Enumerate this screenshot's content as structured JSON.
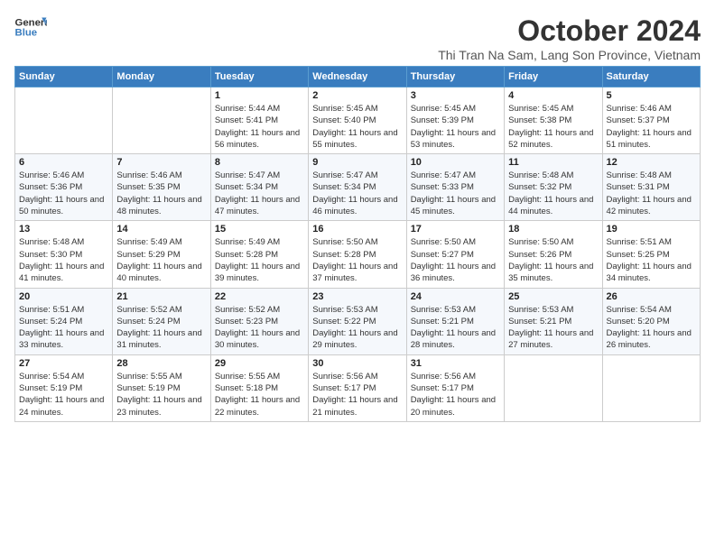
{
  "header": {
    "logo": {
      "line1": "General",
      "line2": "Blue"
    },
    "title": "October 2024",
    "subtitle": "Thi Tran Na Sam, Lang Son Province, Vietnam"
  },
  "days_of_week": [
    "Sunday",
    "Monday",
    "Tuesday",
    "Wednesday",
    "Thursday",
    "Friday",
    "Saturday"
  ],
  "weeks": [
    [
      {
        "day": "",
        "sunrise": "",
        "sunset": "",
        "daylight": ""
      },
      {
        "day": "",
        "sunrise": "",
        "sunset": "",
        "daylight": ""
      },
      {
        "day": "1",
        "sunrise": "Sunrise: 5:44 AM",
        "sunset": "Sunset: 5:41 PM",
        "daylight": "Daylight: 11 hours and 56 minutes."
      },
      {
        "day": "2",
        "sunrise": "Sunrise: 5:45 AM",
        "sunset": "Sunset: 5:40 PM",
        "daylight": "Daylight: 11 hours and 55 minutes."
      },
      {
        "day": "3",
        "sunrise": "Sunrise: 5:45 AM",
        "sunset": "Sunset: 5:39 PM",
        "daylight": "Daylight: 11 hours and 53 minutes."
      },
      {
        "day": "4",
        "sunrise": "Sunrise: 5:45 AM",
        "sunset": "Sunset: 5:38 PM",
        "daylight": "Daylight: 11 hours and 52 minutes."
      },
      {
        "day": "5",
        "sunrise": "Sunrise: 5:46 AM",
        "sunset": "Sunset: 5:37 PM",
        "daylight": "Daylight: 11 hours and 51 minutes."
      }
    ],
    [
      {
        "day": "6",
        "sunrise": "Sunrise: 5:46 AM",
        "sunset": "Sunset: 5:36 PM",
        "daylight": "Daylight: 11 hours and 50 minutes."
      },
      {
        "day": "7",
        "sunrise": "Sunrise: 5:46 AM",
        "sunset": "Sunset: 5:35 PM",
        "daylight": "Daylight: 11 hours and 48 minutes."
      },
      {
        "day": "8",
        "sunrise": "Sunrise: 5:47 AM",
        "sunset": "Sunset: 5:34 PM",
        "daylight": "Daylight: 11 hours and 47 minutes."
      },
      {
        "day": "9",
        "sunrise": "Sunrise: 5:47 AM",
        "sunset": "Sunset: 5:34 PM",
        "daylight": "Daylight: 11 hours and 46 minutes."
      },
      {
        "day": "10",
        "sunrise": "Sunrise: 5:47 AM",
        "sunset": "Sunset: 5:33 PM",
        "daylight": "Daylight: 11 hours and 45 minutes."
      },
      {
        "day": "11",
        "sunrise": "Sunrise: 5:48 AM",
        "sunset": "Sunset: 5:32 PM",
        "daylight": "Daylight: 11 hours and 44 minutes."
      },
      {
        "day": "12",
        "sunrise": "Sunrise: 5:48 AM",
        "sunset": "Sunset: 5:31 PM",
        "daylight": "Daylight: 11 hours and 42 minutes."
      }
    ],
    [
      {
        "day": "13",
        "sunrise": "Sunrise: 5:48 AM",
        "sunset": "Sunset: 5:30 PM",
        "daylight": "Daylight: 11 hours and 41 minutes."
      },
      {
        "day": "14",
        "sunrise": "Sunrise: 5:49 AM",
        "sunset": "Sunset: 5:29 PM",
        "daylight": "Daylight: 11 hours and 40 minutes."
      },
      {
        "day": "15",
        "sunrise": "Sunrise: 5:49 AM",
        "sunset": "Sunset: 5:28 PM",
        "daylight": "Daylight: 11 hours and 39 minutes."
      },
      {
        "day": "16",
        "sunrise": "Sunrise: 5:50 AM",
        "sunset": "Sunset: 5:28 PM",
        "daylight": "Daylight: 11 hours and 37 minutes."
      },
      {
        "day": "17",
        "sunrise": "Sunrise: 5:50 AM",
        "sunset": "Sunset: 5:27 PM",
        "daylight": "Daylight: 11 hours and 36 minutes."
      },
      {
        "day": "18",
        "sunrise": "Sunrise: 5:50 AM",
        "sunset": "Sunset: 5:26 PM",
        "daylight": "Daylight: 11 hours and 35 minutes."
      },
      {
        "day": "19",
        "sunrise": "Sunrise: 5:51 AM",
        "sunset": "Sunset: 5:25 PM",
        "daylight": "Daylight: 11 hours and 34 minutes."
      }
    ],
    [
      {
        "day": "20",
        "sunrise": "Sunrise: 5:51 AM",
        "sunset": "Sunset: 5:24 PM",
        "daylight": "Daylight: 11 hours and 33 minutes."
      },
      {
        "day": "21",
        "sunrise": "Sunrise: 5:52 AM",
        "sunset": "Sunset: 5:24 PM",
        "daylight": "Daylight: 11 hours and 31 minutes."
      },
      {
        "day": "22",
        "sunrise": "Sunrise: 5:52 AM",
        "sunset": "Sunset: 5:23 PM",
        "daylight": "Daylight: 11 hours and 30 minutes."
      },
      {
        "day": "23",
        "sunrise": "Sunrise: 5:53 AM",
        "sunset": "Sunset: 5:22 PM",
        "daylight": "Daylight: 11 hours and 29 minutes."
      },
      {
        "day": "24",
        "sunrise": "Sunrise: 5:53 AM",
        "sunset": "Sunset: 5:21 PM",
        "daylight": "Daylight: 11 hours and 28 minutes."
      },
      {
        "day": "25",
        "sunrise": "Sunrise: 5:53 AM",
        "sunset": "Sunset: 5:21 PM",
        "daylight": "Daylight: 11 hours and 27 minutes."
      },
      {
        "day": "26",
        "sunrise": "Sunrise: 5:54 AM",
        "sunset": "Sunset: 5:20 PM",
        "daylight": "Daylight: 11 hours and 26 minutes."
      }
    ],
    [
      {
        "day": "27",
        "sunrise": "Sunrise: 5:54 AM",
        "sunset": "Sunset: 5:19 PM",
        "daylight": "Daylight: 11 hours and 24 minutes."
      },
      {
        "day": "28",
        "sunrise": "Sunrise: 5:55 AM",
        "sunset": "Sunset: 5:19 PM",
        "daylight": "Daylight: 11 hours and 23 minutes."
      },
      {
        "day": "29",
        "sunrise": "Sunrise: 5:55 AM",
        "sunset": "Sunset: 5:18 PM",
        "daylight": "Daylight: 11 hours and 22 minutes."
      },
      {
        "day": "30",
        "sunrise": "Sunrise: 5:56 AM",
        "sunset": "Sunset: 5:17 PM",
        "daylight": "Daylight: 11 hours and 21 minutes."
      },
      {
        "day": "31",
        "sunrise": "Sunrise: 5:56 AM",
        "sunset": "Sunset: 5:17 PM",
        "daylight": "Daylight: 11 hours and 20 minutes."
      },
      {
        "day": "",
        "sunrise": "",
        "sunset": "",
        "daylight": ""
      },
      {
        "day": "",
        "sunrise": "",
        "sunset": "",
        "daylight": ""
      }
    ]
  ]
}
